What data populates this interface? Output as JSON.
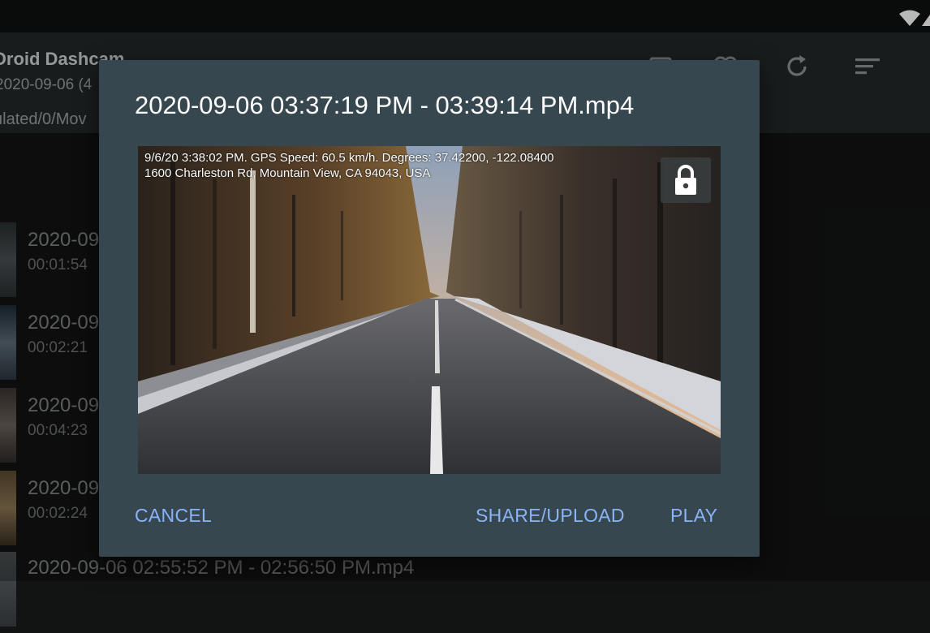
{
  "app": {
    "title": "Droid Dashcam",
    "subtitle": "2020-09-06 (4",
    "path": "ulated/0/Mov"
  },
  "toolbar": {
    "icons": [
      "calendar-icon",
      "link-icon",
      "refresh-icon",
      "sort-icon"
    ]
  },
  "list": {
    "items": [
      {
        "name": "2020-09",
        "duration": "00:01:54"
      },
      {
        "name": "2020-09",
        "duration": "00:02:21"
      },
      {
        "name": "2020-09",
        "duration": "00:04:23"
      },
      {
        "name": "2020-09",
        "duration": "00:02:24"
      },
      {
        "name": "2020-09-06 02:55:52 PM - 02:56:50 PM.mp4",
        "duration": ""
      }
    ]
  },
  "dialog": {
    "title": "2020-09-06 03:37:19 PM - 03:39:14 PM.mp4",
    "overlay_line_1": "9/6/20 3:38:02 PM. GPS Speed: 60.5 km/h. Degrees: 37.42200, -122.08400",
    "overlay_line_2": "1600 Charleston Rd, Mountain View, CA 94043, USA",
    "cancel_label": "CANCEL",
    "share_label": "SHARE/UPLOAD",
    "play_label": "PLAY",
    "accent_color": "#8ab4f8",
    "background_color": "#37474f"
  }
}
